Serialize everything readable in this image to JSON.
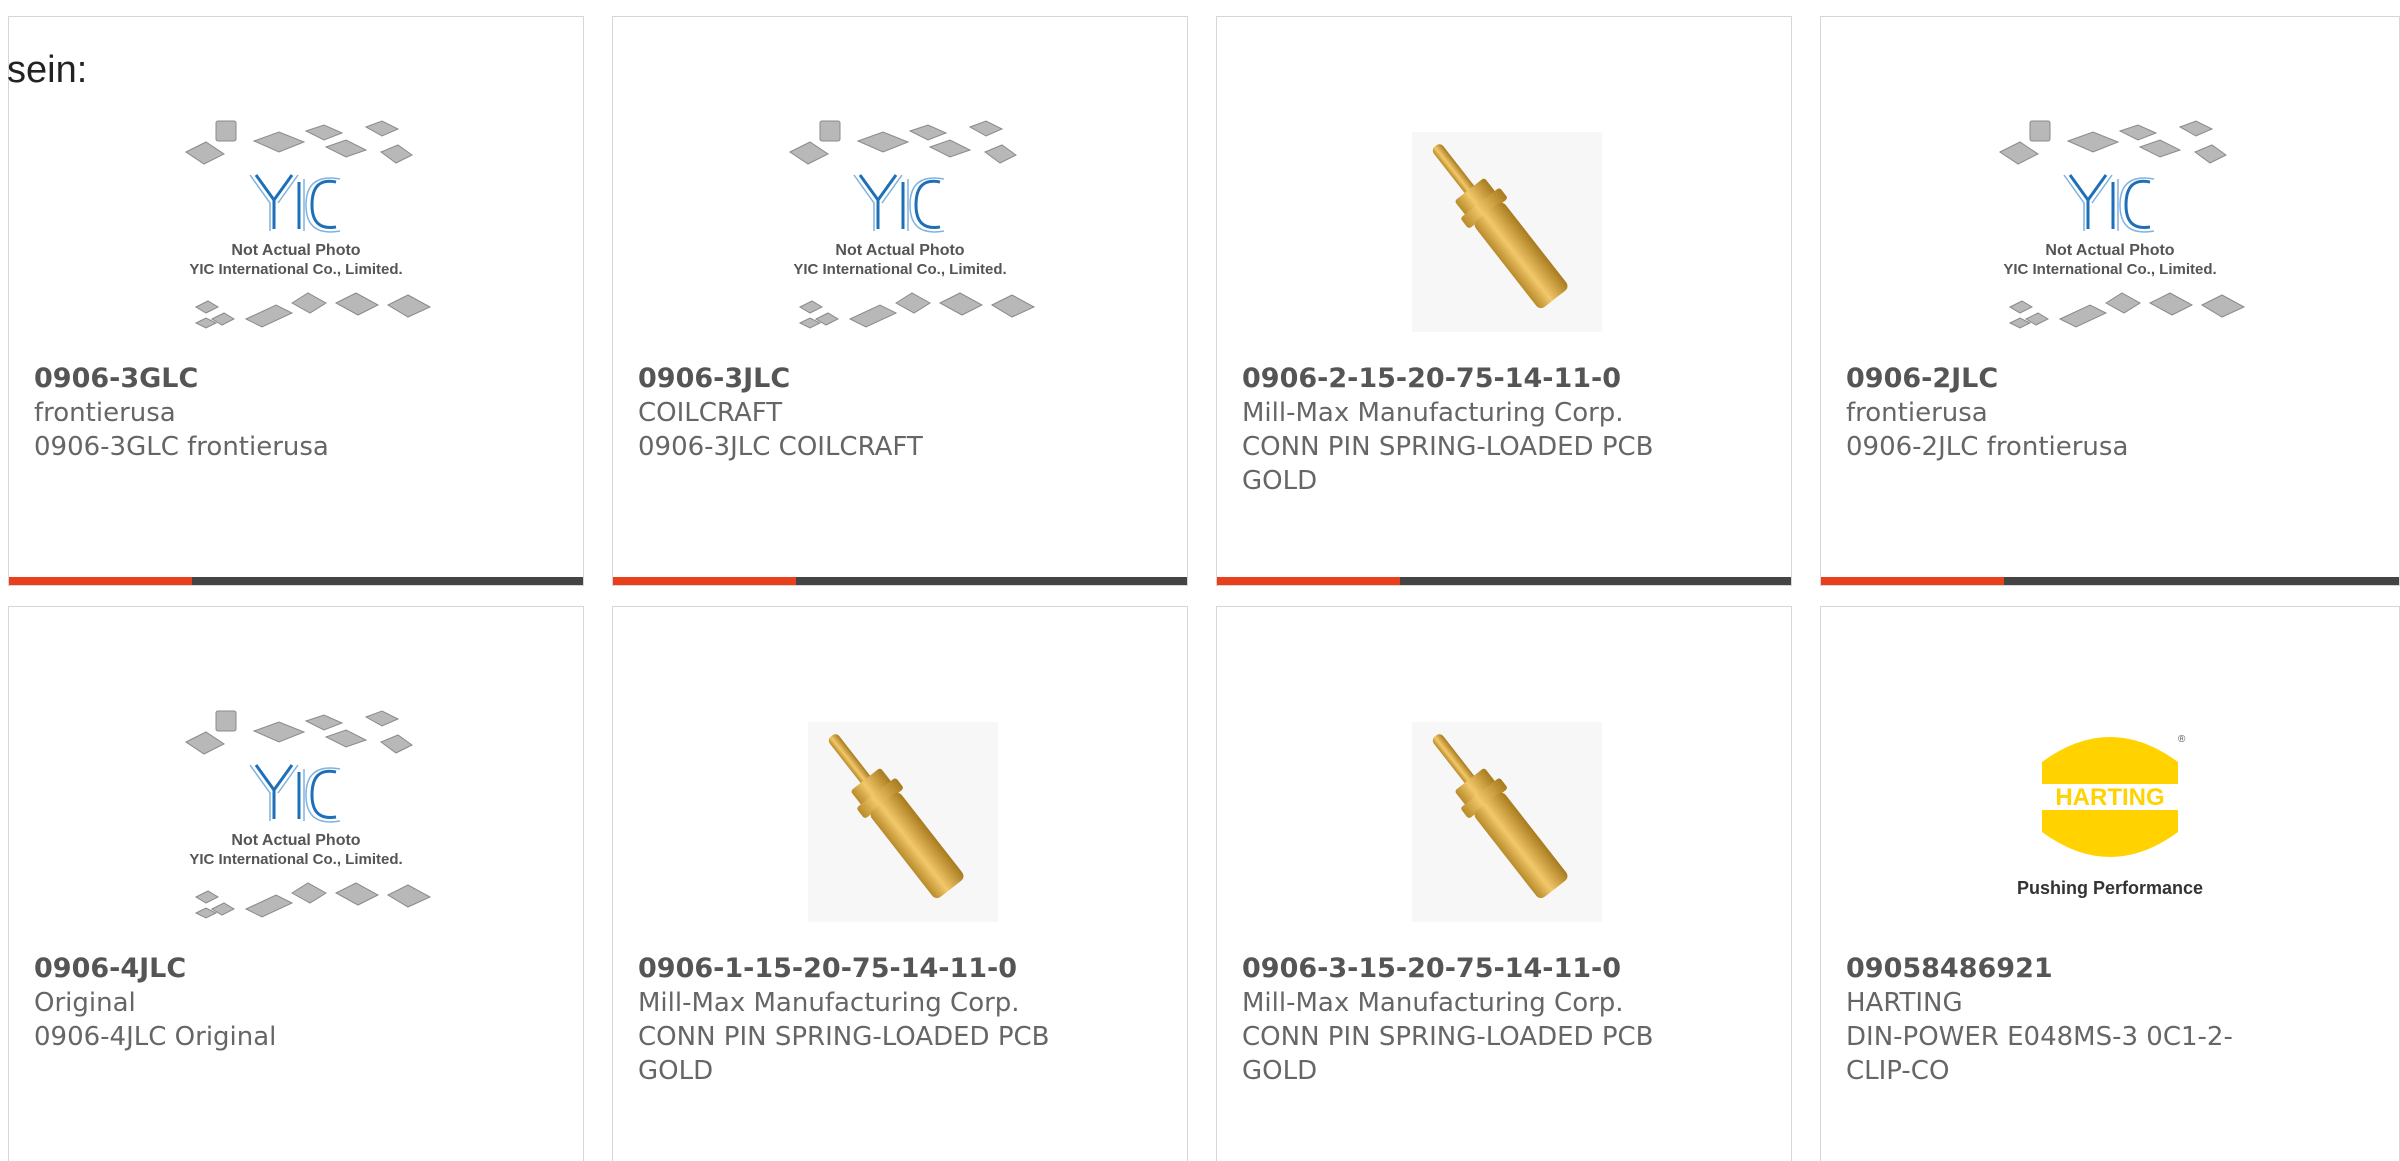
{
  "header": {
    "text": "sein:"
  },
  "cards": [
    {
      "part": "0906-3GLC",
      "manufacturer": "frontierusa",
      "description": "0906-3GLC frontierusa",
      "image": "yic-placeholder",
      "placeholder_line1": "Not Actual Photo",
      "placeholder_line2": "YIC International Co., Limited."
    },
    {
      "part": "0906-3JLC",
      "manufacturer": "COILCRAFT",
      "description": "0906-3JLC COILCRAFT",
      "image": "yic-placeholder",
      "placeholder_line1": "Not Actual Photo",
      "placeholder_line2": "YIC International Co., Limited."
    },
    {
      "part": "0906-2-15-20-75-14-11-0",
      "manufacturer": "Mill-Max Manufacturing Corp.",
      "description": "CONN PIN SPRING-LOADED PCB GOLD",
      "image": "gold-pin"
    },
    {
      "part": "0906-2JLC",
      "manufacturer": "frontierusa",
      "description": "0906-2JLC frontierusa",
      "image": "yic-placeholder",
      "placeholder_line1": "Not Actual Photo",
      "placeholder_line2": "YIC International Co., Limited."
    },
    {
      "part": "0906-4JLC",
      "manufacturer": "Original",
      "description": "0906-4JLC Original",
      "image": "yic-placeholder",
      "placeholder_line1": "Not Actual Photo",
      "placeholder_line2": "YIC International Co., Limited."
    },
    {
      "part": "0906-1-15-20-75-14-11-0",
      "manufacturer": "Mill-Max Manufacturing Corp.",
      "description": "CONN PIN SPRING-LOADED PCB GOLD",
      "image": "gold-pin"
    },
    {
      "part": "0906-3-15-20-75-14-11-0",
      "manufacturer": "Mill-Max Manufacturing Corp.",
      "description": "CONN PIN SPRING-LOADED PCB GOLD",
      "image": "gold-pin"
    },
    {
      "part": "09058486921",
      "manufacturer": "HARTING",
      "description": "DIN-POWER E048MS-3 0C1-2-CLIP-CO",
      "image": "harting-logo",
      "logo_text": "HARTING",
      "logo_tagline": "Pushing Performance"
    }
  ],
  "colors": {
    "accent": "#e8401c",
    "bar": "#444444",
    "border": "#d6d6d6",
    "yic_blue": "#1e6fb8",
    "harting_yellow": "#ffd200"
  }
}
